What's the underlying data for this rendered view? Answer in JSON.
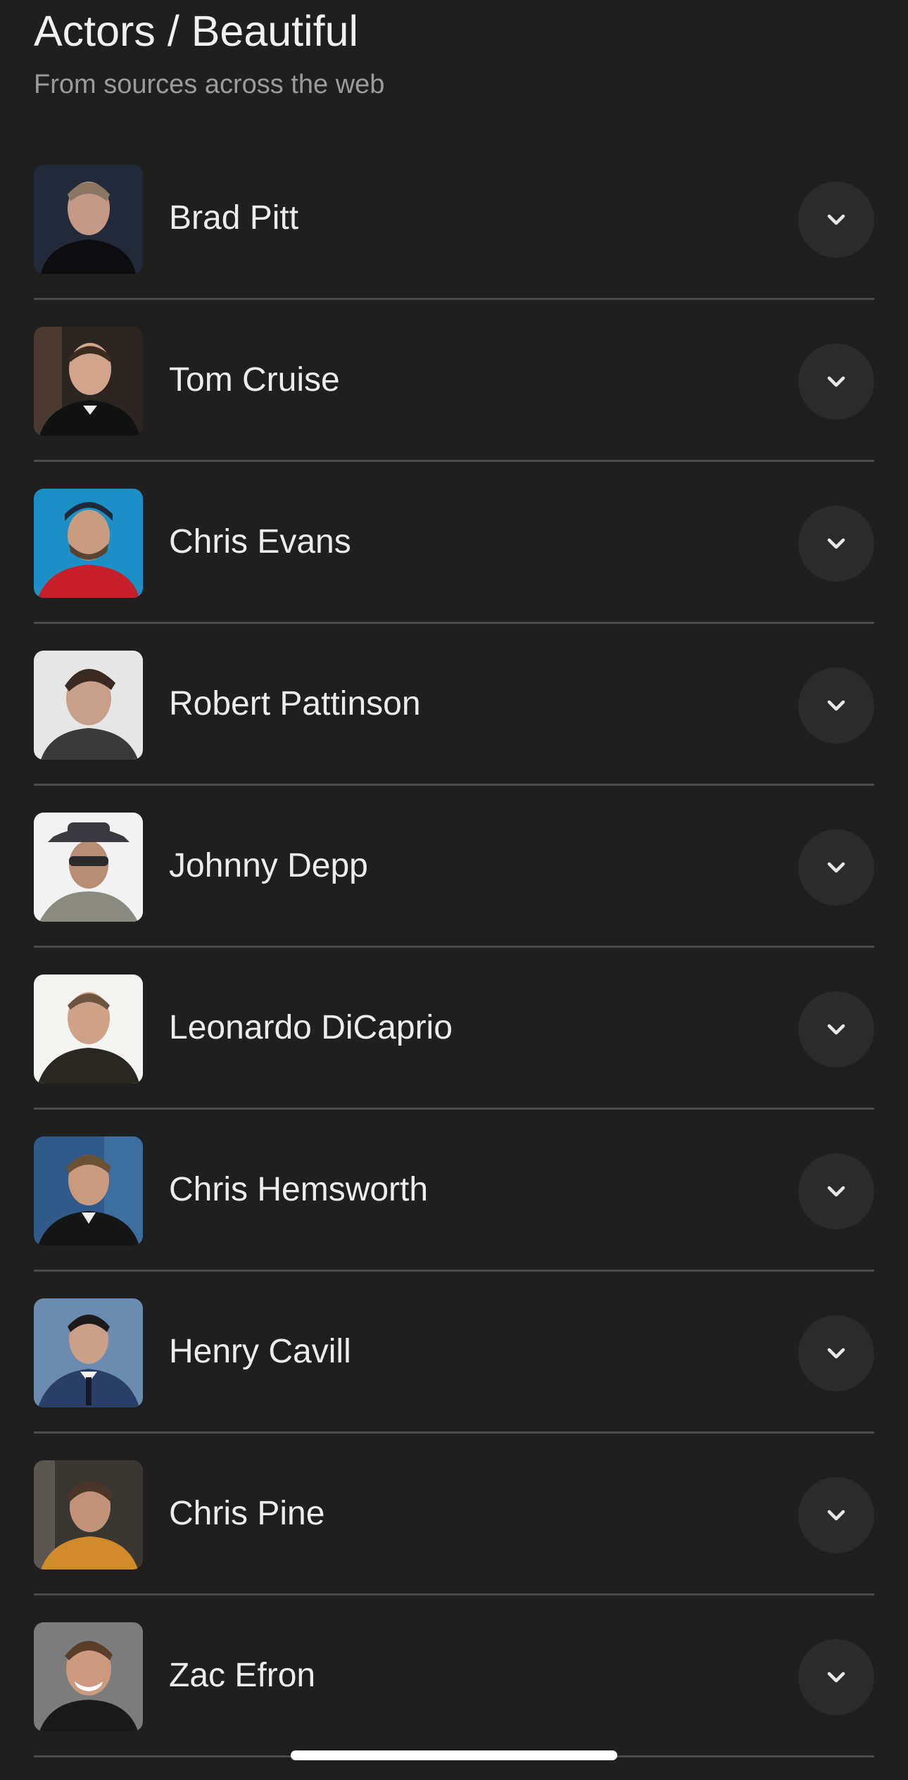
{
  "header": {
    "title": "Actors / Beautiful",
    "subtitle": "From sources across the web"
  },
  "list": {
    "items": [
      {
        "name": "Brad Pitt",
        "icon": "chevron-down-icon"
      },
      {
        "name": "Tom Cruise",
        "icon": "chevron-down-icon"
      },
      {
        "name": "Chris Evans",
        "icon": "chevron-down-icon"
      },
      {
        "name": "Robert Pattinson",
        "icon": "chevron-down-icon"
      },
      {
        "name": "Johnny Depp",
        "icon": "chevron-down-icon"
      },
      {
        "name": "Leonardo DiCaprio",
        "icon": "chevron-down-icon"
      },
      {
        "name": "Chris Hemsworth",
        "icon": "chevron-down-icon"
      },
      {
        "name": "Henry Cavill",
        "icon": "chevron-down-icon"
      },
      {
        "name": "Chris Pine",
        "icon": "chevron-down-icon"
      },
      {
        "name": "Zac Efron",
        "icon": "chevron-down-icon"
      }
    ]
  },
  "colors": {
    "background": "#1f1f1f",
    "divider": "#4a4a4a",
    "button_bg": "#2b2b2b",
    "text": "#ececec",
    "subtext": "#9b9b9b"
  }
}
